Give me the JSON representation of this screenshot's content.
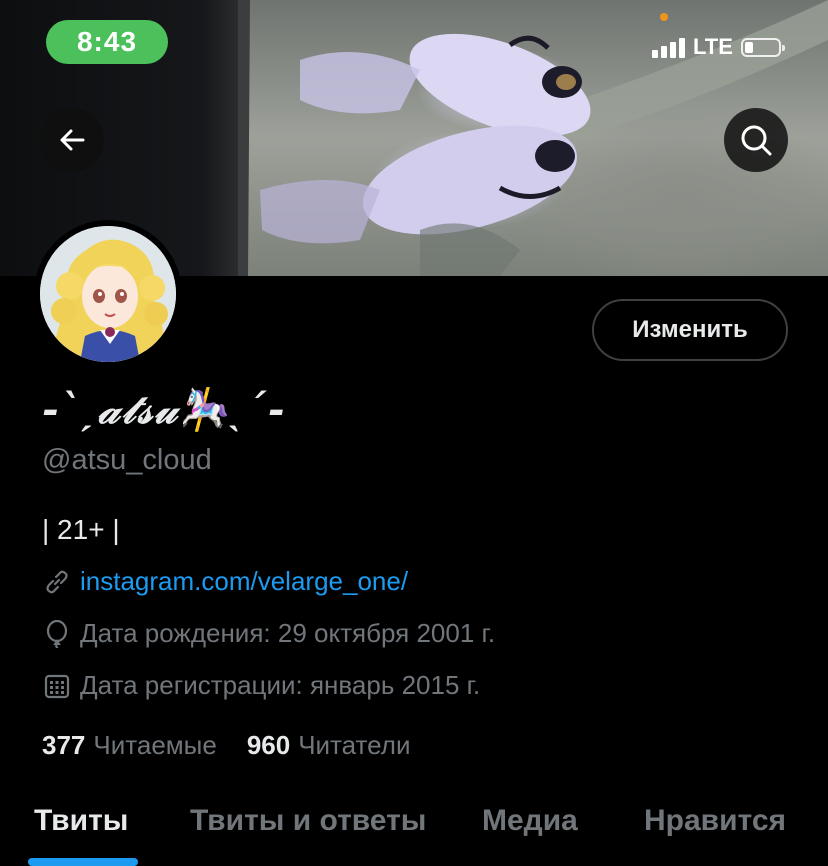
{
  "status_bar": {
    "time": "8:43",
    "network": "LTE"
  },
  "header": {
    "back_icon": "arrow-left-icon",
    "search_icon": "search-icon"
  },
  "profile": {
    "display_name": "-ˋˏ𝒶𝓉𝓈𝓊🎠ˎˊ-",
    "handle": "@atsu_cloud",
    "bio": "| 21+ |",
    "link": "instagram.com/velarge_one/",
    "birthday": "Дата рождения: 29 октября 2001 г.",
    "joined": "Дата регистрации: январь 2015 г.",
    "edit_button": "Изменить",
    "following_count": "377",
    "following_label": "Читаемые",
    "followers_count": "960",
    "followers_label": "Читатели"
  },
  "tabs": [
    {
      "label": "Твиты",
      "active": true
    },
    {
      "label": "Твиты и ответы",
      "active": false
    },
    {
      "label": "Медиа",
      "active": false
    },
    {
      "label": "Нравится",
      "active": false
    }
  ],
  "colors": {
    "accent": "#1d9bf0",
    "background": "#000000",
    "muted_text": "#71767b",
    "status_time_bg": "#4cc05a"
  }
}
